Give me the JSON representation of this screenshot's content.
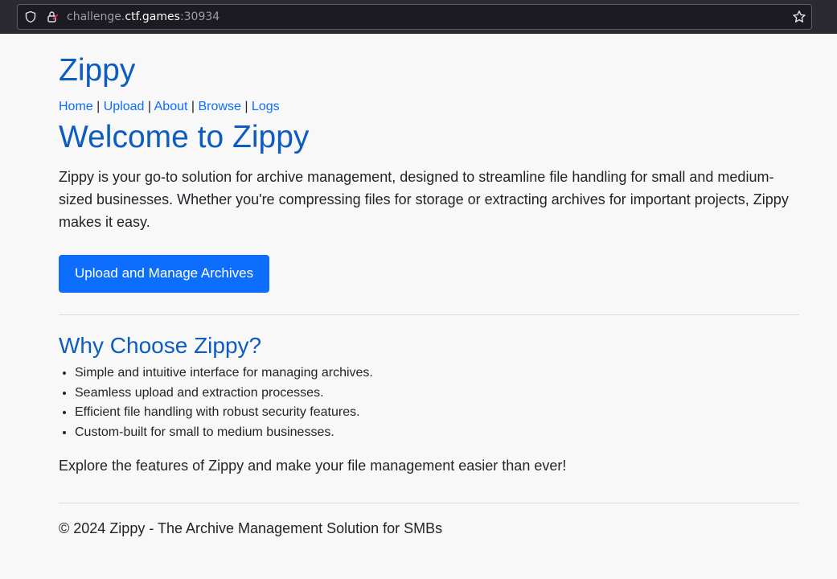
{
  "browser": {
    "url_prefix": "challenge.",
    "url_host": "ctf.games",
    "url_port": ":30934"
  },
  "site": {
    "brand": "Zippy",
    "nav": [
      {
        "label": "Home"
      },
      {
        "label": "Upload"
      },
      {
        "label": "About"
      },
      {
        "label": "Browse"
      },
      {
        "label": "Logs"
      }
    ],
    "nav_separator": "|"
  },
  "main": {
    "heading": "Welcome to Zippy",
    "intro": "Zippy is your go-to solution for archive management, designed to streamline file handling for small and medium-sized businesses. Whether you're compressing files for storage or extracting archives for important projects, Zippy makes it easy.",
    "cta_label": "Upload and Manage Archives",
    "why_heading": "Why Choose Zippy?",
    "features": [
      "Simple and intuitive interface for managing archives.",
      "Seamless upload and extraction processes.",
      "Efficient file handling with robust security features.",
      "Custom-built for small to medium businesses."
    ],
    "explore": "Explore the features of Zippy and make your file management easier than ever!"
  },
  "footer": {
    "text": "© 2024 Zippy - The Archive Management Solution for SMBs"
  },
  "icons": {
    "shield": "shield-icon",
    "lock": "lock-icon",
    "star": "star-icon"
  },
  "colors": {
    "accent": "#0d6efd",
    "heading": "#0d5cbf",
    "background": "#f8f8f8"
  }
}
